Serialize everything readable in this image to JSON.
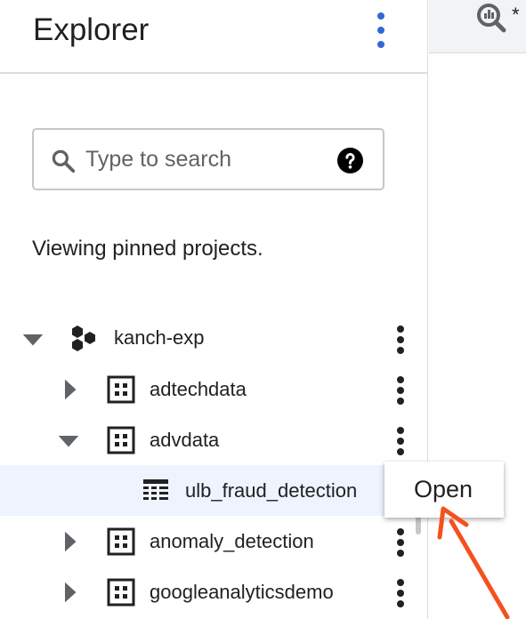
{
  "explorer": {
    "title": "Explorer",
    "search": {
      "placeholder": "Type to search",
      "value": ""
    },
    "status_text": "Viewing pinned projects."
  },
  "tree": [
    {
      "label": "kanch-exp",
      "type": "project",
      "expanded": true,
      "level": 0
    },
    {
      "label": "adtechdata",
      "type": "dataset",
      "expanded": false,
      "level": 1
    },
    {
      "label": "advdata",
      "type": "dataset",
      "expanded": true,
      "level": 1
    },
    {
      "label": "ulb_fraud_detection",
      "type": "table",
      "selected": true,
      "level": 2
    },
    {
      "label": "anomaly_detection",
      "type": "dataset",
      "expanded": false,
      "level": 1
    },
    {
      "label": "googleanalyticsdemo",
      "type": "dataset",
      "expanded": false,
      "level": 1
    }
  ],
  "context_menu": {
    "items": [
      "Open"
    ]
  },
  "right_panel": {
    "tab_marker": "*",
    "tab_icon": "query-icon"
  },
  "icons": {
    "search": "search-icon",
    "help": "help-icon",
    "more": "more-vert-icon",
    "project": "project-hexagon-icon",
    "dataset": "dataset-grid-icon",
    "table": "table-icon",
    "expand": "caret-right-icon",
    "collapse": "caret-down-icon"
  },
  "colors": {
    "accent": "#3367d6",
    "selected_row": "#eef3fd",
    "annotation_arrow": "#f4511e",
    "divider": "#dadce0"
  }
}
